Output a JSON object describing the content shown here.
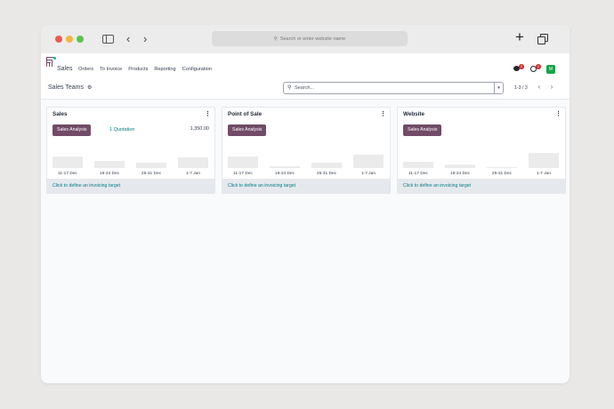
{
  "browser": {
    "url_placeholder": "Search or enter website name",
    "url_icon": "magnifier-icon"
  },
  "app": {
    "name": "Sales",
    "menu": [
      "Orders",
      "To Invoice",
      "Products",
      "Reporting",
      "Configuration"
    ],
    "chat_badge": "5",
    "activity_badge": "2",
    "avatar_initial": "M",
    "brand_color": "#714b67",
    "link_color": "#017e84"
  },
  "control": {
    "breadcrumb": "Sales Teams",
    "search_placeholder": "Search...",
    "pager": "1-3 / 3"
  },
  "cards": [
    {
      "title": "Sales",
      "button": "Sales Analysis",
      "quotation": "1 Quotation",
      "amount": "1,350.00",
      "bars": [
        {
          "label": "11-17 Dec",
          "value": 0.55
        },
        {
          "label": "18-24 Dec",
          "value": 0.35
        },
        {
          "label": "25-31 Dec",
          "value": 0.25
        },
        {
          "label": "1-7 Jan",
          "value": 0.5
        }
      ],
      "footer": "Click to define an invoicing target"
    },
    {
      "title": "Point of Sale",
      "button": "Sales Analysis",
      "quotation": "",
      "amount": "",
      "bars": [
        {
          "label": "11-17 Dec",
          "value": 0.55
        },
        {
          "label": "18-24 Dec",
          "value": 0.08
        },
        {
          "label": "25-31 Dec",
          "value": 0.25
        },
        {
          "label": "1-7 Jan",
          "value": 0.62
        }
      ],
      "footer": "Click to define an invoicing target"
    },
    {
      "title": "Website",
      "button": "Sales Analysis",
      "quotation": "",
      "amount": "",
      "bars": [
        {
          "label": "11-17 Dec",
          "value": 0.3
        },
        {
          "label": "18-24 Dec",
          "value": 0.15
        },
        {
          "label": "25-31 Dec",
          "value": 0.04
        },
        {
          "label": "1-7 Jan",
          "value": 0.72
        }
      ],
      "footer": "Click to define an invoicing target"
    }
  ]
}
